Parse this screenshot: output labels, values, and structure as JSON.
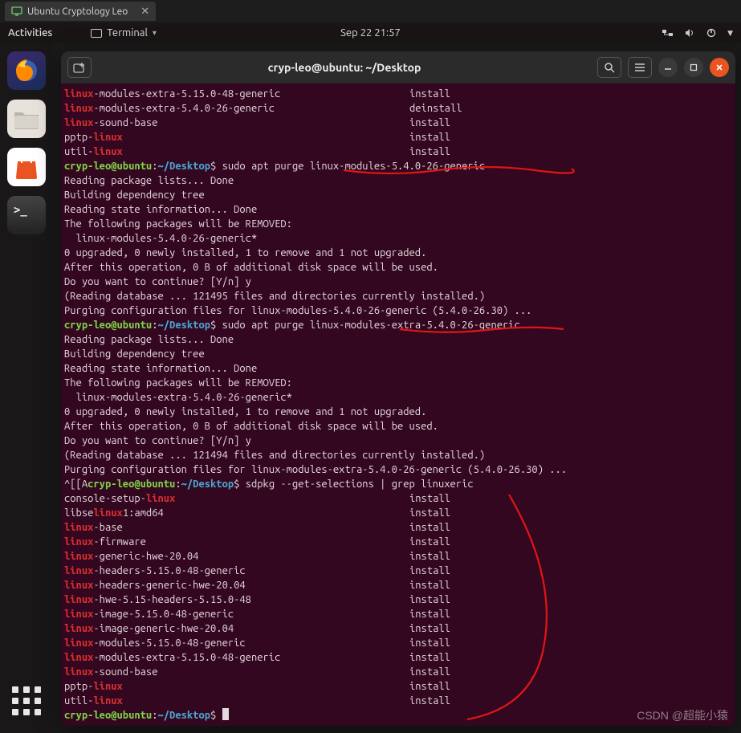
{
  "vm_tab": {
    "label": "Ubuntu Cryptology Leo",
    "close": "✕"
  },
  "topbar": {
    "activities": "Activities",
    "terminal": "Terminal",
    "clock": "Sep 22  21:57",
    "chevron": "▾"
  },
  "title": "cryp-leo@ubuntu: ~/Desktop",
  "prompt": {
    "user": "cryp-leo@ubuntu",
    "colon": ":",
    "path": "~/Desktop",
    "dollar": "$"
  },
  "cmds": {
    "c1": "sudo apt purge linux-modules-5.4.0-26-generic",
    "c2": "sudo apt purge linux-modules-extra-5.4.0-26-generic",
    "c3prefix": "^[[A",
    "c3": "sdpkg --get-selections | grep linuxeric"
  },
  "blocks": {
    "top_pkgs": [
      {
        "pre": "linux",
        "post": "-modules-extra-5.15.0-48-generic",
        "state": "install"
      },
      {
        "pre": "linux",
        "post": "-modules-extra-5.4.0-26-generic",
        "state": "deinstall"
      },
      {
        "pre": "linux",
        "post": "-sound-base",
        "state": "install"
      },
      {
        "preplain": "pptp-",
        "pre": "linux",
        "post": "",
        "state": "install"
      },
      {
        "preplain": "util-",
        "pre": "linux",
        "post": "",
        "state": "install"
      }
    ],
    "purge1": [
      "Reading package lists... Done",
      "Building dependency tree",
      "Reading state information... Done",
      "The following packages will be REMOVED:",
      "  linux-modules-5.4.0-26-generic*",
      "0 upgraded, 0 newly installed, 1 to remove and 1 not upgraded.",
      "After this operation, 0 B of additional disk space will be used.",
      "Do you want to continue? [Y/n] y",
      "(Reading database ... 121495 files and directories currently installed.)",
      "Purging configuration files for linux-modules-5.4.0-26-generic (5.4.0-26.30) ..."
    ],
    "purge2": [
      "Reading package lists... Done",
      "Building dependency tree",
      "Reading state information... Done",
      "The following packages will be REMOVED:",
      "  linux-modules-extra-5.4.0-26-generic*",
      "0 upgraded, 0 newly installed, 1 to remove and 1 not upgraded.",
      "After this operation, 0 B of additional disk space will be used.",
      "Do you want to continue? [Y/n] y",
      "(Reading database ... 121494 files and directories currently installed.)",
      "Purging configuration files for linux-modules-extra-5.4.0-26-generic (5.4.0-26.30) ..."
    ],
    "list": [
      {
        "preplain": "console-setup-",
        "pre": "linux",
        "post": "",
        "state": "install"
      },
      {
        "preplain": "libse",
        "pre": "linux",
        "post": "1:amd64",
        "state": "install"
      },
      {
        "pre": "linux",
        "post": "-base",
        "state": "install"
      },
      {
        "pre": "linux",
        "post": "-firmware",
        "state": "install"
      },
      {
        "pre": "linux",
        "post": "-generic-hwe-20.04",
        "state": "install"
      },
      {
        "pre": "linux",
        "post": "-headers-5.15.0-48-generic",
        "state": "install"
      },
      {
        "pre": "linux",
        "post": "-headers-generic-hwe-20.04",
        "state": "install"
      },
      {
        "pre": "linux",
        "post": "-hwe-5.15-headers-5.15.0-48",
        "state": "install"
      },
      {
        "pre": "linux",
        "post": "-image-5.15.0-48-generic",
        "state": "install"
      },
      {
        "pre": "linux",
        "post": "-image-generic-hwe-20.04",
        "state": "install"
      },
      {
        "pre": "linux",
        "post": "-modules-5.15.0-48-generic",
        "state": "install"
      },
      {
        "pre": "linux",
        "post": "-modules-extra-5.15.0-48-generic",
        "state": "install"
      },
      {
        "pre": "linux",
        "post": "-sound-base",
        "state": "install"
      },
      {
        "preplain": "pptp-",
        "pre": "linux",
        "post": "",
        "state": "install"
      },
      {
        "preplain": "util-",
        "pre": "linux",
        "post": "",
        "state": "install"
      }
    ]
  },
  "watermark": "CSDN @超能小猿"
}
